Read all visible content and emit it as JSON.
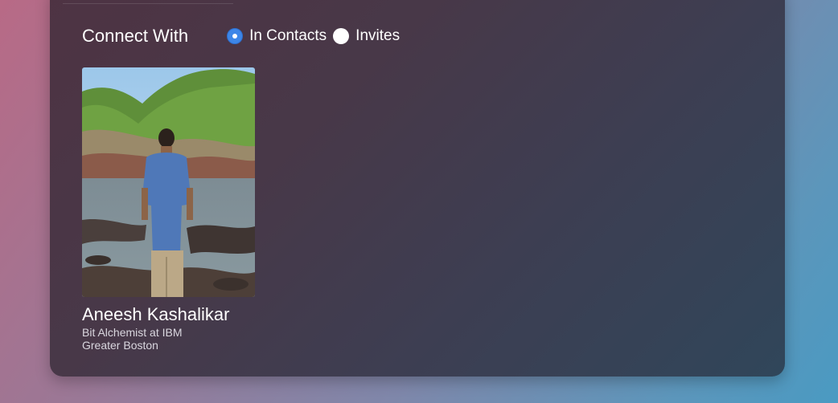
{
  "connect": {
    "title": "Connect With",
    "options": [
      {
        "label": "In Contacts",
        "selected": true
      },
      {
        "label": "Invites",
        "selected": false
      }
    ]
  },
  "contacts": [
    {
      "name": "Aneesh Kashalikar",
      "headline": "Bit Alchemist at IBM",
      "location": "Greater Boston"
    }
  ],
  "colors": {
    "radio_accent": "#3d86e8",
    "text_primary": "#ffffff",
    "text_secondary": "#d9d6de"
  }
}
